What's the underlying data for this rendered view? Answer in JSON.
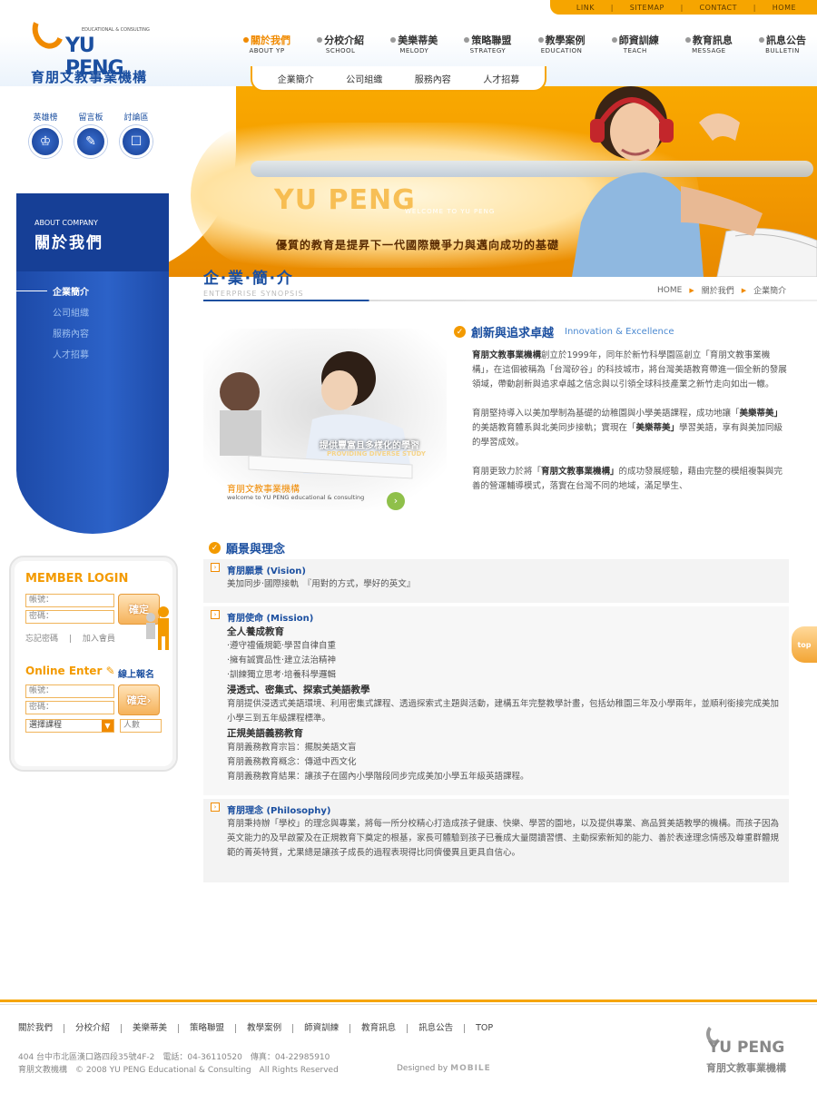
{
  "util_links": [
    "LINK",
    "SITEMAP",
    "CONTACT",
    "HOME"
  ],
  "logo": {
    "en": "YU PENG",
    "tag": "EDUCATIONAL & CONSULTING",
    "cn": "育朋文教事業機構"
  },
  "main_nav": [
    {
      "zh": "關於我們",
      "en": "ABOUT YP",
      "active": true
    },
    {
      "zh": "分校介紹",
      "en": "SCHOOL"
    },
    {
      "zh": "美樂蒂美",
      "en": "MELODY"
    },
    {
      "zh": "策略聯盟",
      "en": "STRATEGY"
    },
    {
      "zh": "教學案例",
      "en": "EDUCATION"
    },
    {
      "zh": "師資訓練",
      "en": "TEACH"
    },
    {
      "zh": "教育訊息",
      "en": "MESSAGE"
    },
    {
      "zh": "訊息公告",
      "en": "BULLETIN"
    }
  ],
  "sub_nav": [
    "企業簡介",
    "公司組織",
    "服務內容",
    "人才招募"
  ],
  "quick_links": [
    {
      "label": "英雄榜",
      "icon": "trophy-icon"
    },
    {
      "label": "留言板",
      "icon": "pencil-icon"
    },
    {
      "label": "討論區",
      "icon": "chat-icon"
    }
  ],
  "banner": {
    "title": "YU PENG",
    "welcome": "WELCOME TO YU PENG",
    "slogan": "優質的教育是提昇下一代國際競爭力與邁向成功的基礎"
  },
  "sidebar": {
    "about_en": "ABOUT COMPANY",
    "about_zh": "關於我們",
    "items": [
      "企業簡介",
      "公司組織",
      "服務內容",
      "人才招募"
    ]
  },
  "login": {
    "title": "MEMBER LOGIN",
    "account_label": "帳號：",
    "password_label": "密碼：",
    "ok_label": "確定",
    "forgot": "忘記密碼",
    "join": "加入會員",
    "online_title": "Online Enter",
    "online_sub": "線上報名",
    "select_course": "選擇課程",
    "people": "人數"
  },
  "page": {
    "title_zh": "企‧業‧簡‧介",
    "title_en": "ENTERPRISE SYNOPSIS",
    "breadcrumb": [
      "HOME",
      "關於我們",
      "企業簡介"
    ]
  },
  "intro": {
    "heading_zh": "創新與追求卓越",
    "heading_en": "Innovation & Excellence",
    "img_caption1": "提供豐富且多樣化的學習",
    "img_caption1_en": "PROVIDING DIVERSE STUDY",
    "img_caption2": "育朋文教事業機構",
    "img_caption2_en": "welcome to YU PENG educational & consulting",
    "p1_bold": "育朋文教事業機構",
    "p1_rest": "創立於1999年，同年於新竹科學園區創立「育朋文教事業機構」，在這個被稱為「台灣矽谷」的科技城市，將台灣美語教育帶進一個全新的發展領域，帶動創新與追求卓越之信念與以引領全球科技產業之新竹走向如出一轍。",
    "p2_a": "育朋堅持導入以美加學制為基礎的幼稚園與小學美語課程，成功地讓「",
    "p2_bold": "美樂蒂美」",
    "p2_b": "的美語教育體系與北美同步接軌；實現在「",
    "p2_bold2": "美樂蒂美」",
    "p2_c": "學習美語，享有與美加同級的學習成效。",
    "p3_a": "育朋更致力於將「",
    "p3_bold": "育朋文教事業機構」",
    "p3_b": "的成功發展經驗，藉由完整的模組複製與完善的營運輔導模式，落實在台灣不同的地域，滿足學生、"
  },
  "vision": {
    "heading": "願景與理念",
    "vision_title": "育朋願景 (Vision)",
    "vision_text": "美加同步‧國際接軌　『用對的方式，學好的英文』",
    "mission_title": "育朋使命 (Mission)",
    "mission_lines": [
      {
        "text": "全人養成教育",
        "sub": true
      },
      {
        "text": "‧遵守禮儀規範‧學習自律自重"
      },
      {
        "text": "‧擁有誠實品性‧建立法治精神"
      },
      {
        "text": "‧訓練獨立思考‧培養科學邏輯"
      },
      {
        "text": "浸透式、密集式、探索式美語教學",
        "sub": true
      },
      {
        "text": "育朋提供浸透式美語環境、利用密集式課程、透過探索式主題與活動，建構五年完整教學計畫，包括幼稚園三年及小學兩年，並順利銜接完成美加小學三到五年級課程標準。"
      },
      {
        "text": "正規美語義務教育",
        "sub": true
      },
      {
        "text": "育朋義務教育宗旨：擺脫美語文盲"
      },
      {
        "text": "育朋義務教育概念：傳遞中西文化"
      },
      {
        "text": "育朋義務教育結果：讓孩子在國內小學階段同步完成美加小學五年級英語課程。"
      }
    ],
    "philosophy_title": "育朋理念 (Philosophy)",
    "philosophy_text": "育朋秉持辦「學校」的理念與專業，將每一所分校精心打造成孩子健康、快樂、學習的園地，以及提供專業、高品質美語教學的機構。而孩子因為英文能力的及早啟蒙及在正規教育下奠定的根基，家長可體驗到孩子已養成大量閱讀習慣、主動探索新知的能力、善於表達理念情感及尊重群體規範的菁英特質，尤果總是讓孩子成長的過程表現得比同儕優異且更具自信心。"
  },
  "top_btn": "top",
  "footer": {
    "nav": [
      "關於我們",
      "分校介紹",
      "美樂蒂美",
      "策略聯盟",
      "教學案例",
      "師資訓練",
      "教育訊息",
      "訊息公告",
      "TOP"
    ],
    "address": "404 台中市北區漢口路四段35號4F-2　電話：04-36110520　傳真：04-22985910",
    "copyright": "育朋文教機構　© 2008 YU PENG Educational & Consulting　All Rights Reserved",
    "designed": "Designed by",
    "designer": "MOBILE",
    "logo_en": "YU PENG",
    "logo_cn": "育朋文教事業機構"
  }
}
